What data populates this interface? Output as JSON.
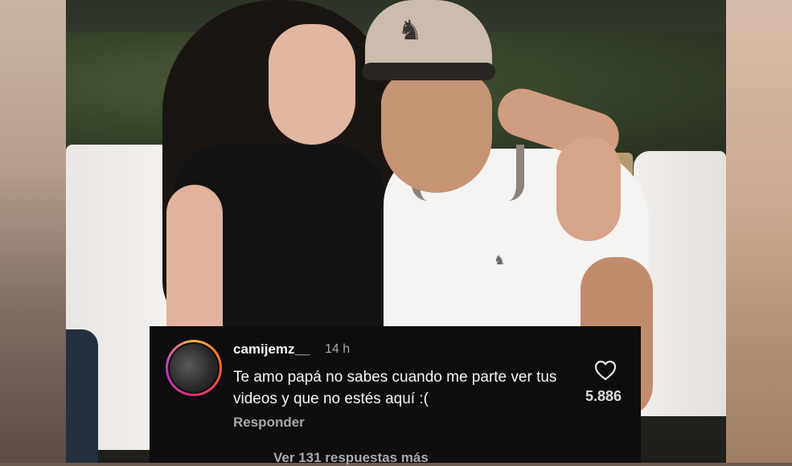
{
  "comment": {
    "username": "camijemz__",
    "time": "14 h",
    "text": "Te amo papá no sabes cuando me parte ver tus videos y que no estés aquí :(",
    "reply_label": "Responder",
    "likes": "5.886",
    "more_replies": "Ver 131 respuestas más"
  },
  "icons": {
    "like": "heart-icon"
  },
  "colors": {
    "overlay_bg": "#0d0d0f",
    "story_ring_start": "#ffb13d",
    "story_ring_end": "#b637c8",
    "muted_text": "#a8a8a8"
  }
}
